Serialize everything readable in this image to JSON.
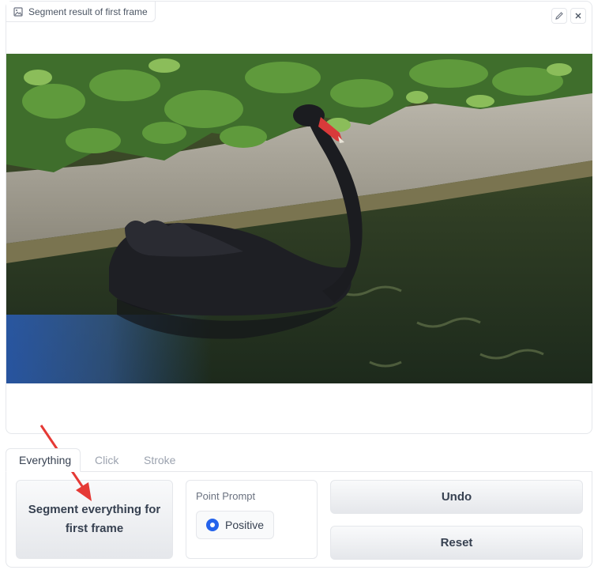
{
  "image_component": {
    "label": "Segment result of first frame",
    "icons": [
      "image-icon",
      "edit-icon",
      "close-icon"
    ]
  },
  "tabs": [
    {
      "label": "Everything",
      "active": true
    },
    {
      "label": "Click",
      "active": false
    },
    {
      "label": "Stroke",
      "active": false
    }
  ],
  "controls": {
    "segment_button": "Segment everything for first frame",
    "point_prompt": {
      "title": "Point Prompt",
      "options": [
        "Positive"
      ],
      "selected": "Positive"
    },
    "undo_button": "Undo",
    "reset_button": "Reset"
  },
  "colors": {
    "accent": "#2563eb",
    "annotation_arrow": "#e53935"
  }
}
